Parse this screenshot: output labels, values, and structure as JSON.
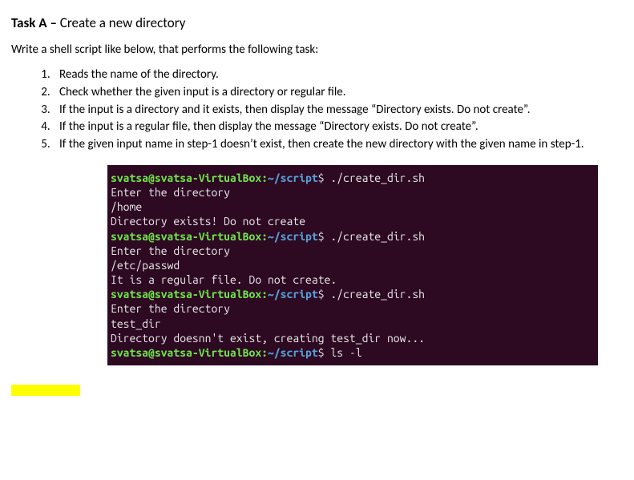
{
  "heading": {
    "task_label": "Task A – ",
    "task_title": "Create a new directory"
  },
  "intro": "Write a shell script like below, that performs the following task:",
  "steps": [
    "Reads the name of the directory.",
    "Check whether the given input is a directory or regular file.",
    "If the input is a directory and it exists, then display the message “Directory exists.  Do not create”.",
    "If the input is a regular file, then display the message “Directory exists.  Do not create”.",
    "If the given input name in step-1 doesn’t exist, then create the new directory with the given name in step-1."
  ],
  "terminal": {
    "prompt_user": "svatsa@svatsa-VirtualBox:",
    "prompt_path": "~/script",
    "prompt_symbol": "$ ",
    "lines": [
      {
        "type": "cmd",
        "text": "./create_dir.sh"
      },
      {
        "type": "out",
        "text": "Enter the directory"
      },
      {
        "type": "out",
        "text": "/home"
      },
      {
        "type": "out",
        "text": "Directory exists! Do not create"
      },
      {
        "type": "cmd",
        "text": "./create_dir.sh"
      },
      {
        "type": "out",
        "text": "Enter the directory"
      },
      {
        "type": "out",
        "text": "/etc/passwd"
      },
      {
        "type": "out",
        "text": "It is a regular file. Do not create."
      },
      {
        "type": "cmd",
        "text": "./create_dir.sh"
      },
      {
        "type": "out",
        "text": "Enter the directory"
      },
      {
        "type": "out",
        "text": "test_dir"
      },
      {
        "type": "out",
        "text": "Directory doesnn't exist, creating test_dir now..."
      },
      {
        "type": "cmd",
        "text": "ls -l"
      }
    ]
  }
}
